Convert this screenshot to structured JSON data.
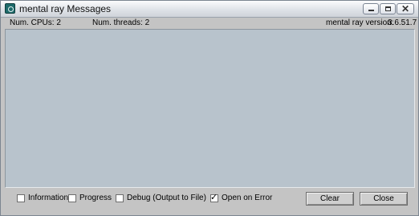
{
  "window": {
    "title": "mental ray Messages",
    "icon": "mental-ray-app-icon",
    "controls": [
      "minimize",
      "maximize",
      "close"
    ]
  },
  "info": {
    "cpus": "Num. CPUs: 2",
    "threads": "Num. threads: 2",
    "version_label": "mental ray version:",
    "version_value": "3.6.51.7"
  },
  "messages": [],
  "options": [
    {
      "label": "Information",
      "checked": false
    },
    {
      "label": "Progress",
      "checked": false
    },
    {
      "label": "Debug (Output to File)",
      "checked": false
    },
    {
      "label": "Open on Error",
      "checked": true
    }
  ],
  "buttons": {
    "clear": "Clear",
    "close": "Close"
  },
  "colors": {
    "message_background": "#b8c3cc",
    "dialog_background": "#c4c4c4"
  }
}
